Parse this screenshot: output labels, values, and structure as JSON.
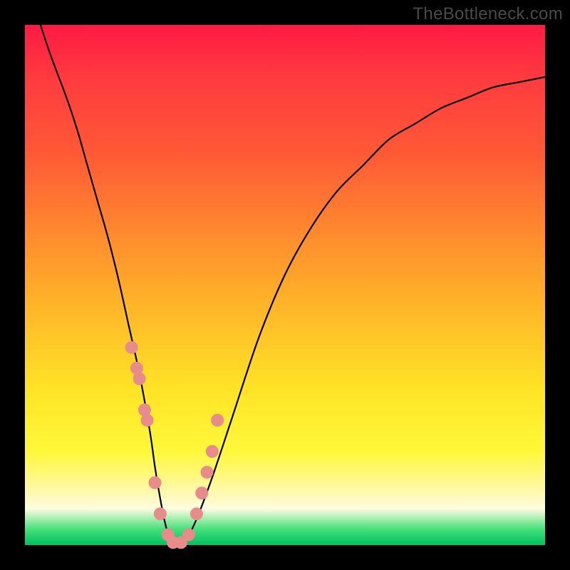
{
  "attribution": "TheBottleneck.com",
  "chart_data": {
    "type": "line",
    "title": "",
    "xlabel": "",
    "ylabel": "",
    "xlim": [
      0,
      100
    ],
    "ylim": [
      0,
      100
    ],
    "background": "rainbow-gradient-red-top-green-bottom",
    "series": [
      {
        "name": "bottleneck-curve",
        "x": [
          3,
          5,
          8,
          10,
          12,
          14,
          16,
          18,
          20,
          22,
          24,
          25,
          26,
          27,
          28,
          29,
          30,
          31,
          33,
          36,
          40,
          45,
          50,
          55,
          60,
          65,
          70,
          75,
          80,
          85,
          90,
          95,
          100
        ],
        "values": [
          100,
          94,
          86,
          80,
          73,
          66,
          59,
          51,
          42,
          33,
          22,
          15,
          9,
          4,
          1,
          0,
          0,
          1,
          5,
          13,
          25,
          40,
          52,
          61,
          68,
          73,
          78,
          81,
          84,
          86,
          88,
          89,
          90
        ]
      }
    ],
    "markers": {
      "name": "highlight-dots",
      "color": "#e88b8b",
      "points_x": [
        20.5,
        21.5,
        22.0,
        23.0,
        23.5,
        25.0,
        26.0,
        27.5,
        28.5,
        30.0,
        31.5,
        33.0,
        34.0,
        35.0,
        36.0,
        37.0
      ],
      "points_y": [
        38,
        34,
        32,
        26,
        24,
        12,
        6,
        2,
        0.5,
        0.5,
        2,
        6,
        10,
        14,
        18,
        24
      ]
    }
  }
}
